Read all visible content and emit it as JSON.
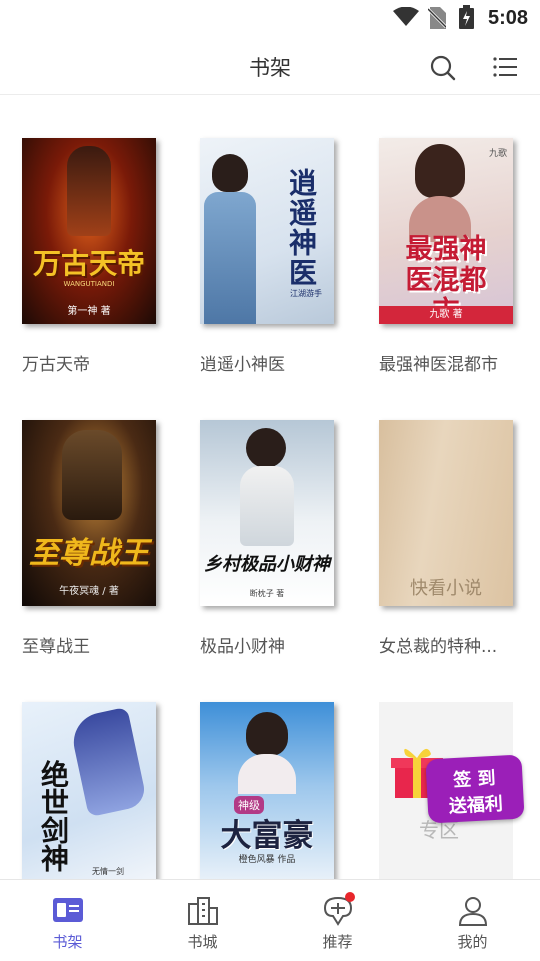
{
  "status_bar": {
    "time": "5:08"
  },
  "header": {
    "title": "书架"
  },
  "books": [
    {
      "title": "万古天帝",
      "cover_text": {
        "main": "万古天帝",
        "pinyin": "WANGUTIANDI",
        "author": "第一神 著"
      }
    },
    {
      "title": "逍遥小神医",
      "cover_text": {
        "main": "逍遥神医",
        "author": "江湖游手"
      }
    },
    {
      "title": "最强神医混都市",
      "cover_text": {
        "main": "最强神医混都市",
        "author": "九歌 著",
        "corner": "九歌"
      }
    },
    {
      "title": "至尊战王",
      "cover_text": {
        "main": "至尊战王",
        "author": "午夜冥魂 / 著"
      }
    },
    {
      "title": "极品小财神",
      "cover_text": {
        "main": "乡村极品小财神",
        "author": "断枕子 著"
      }
    },
    {
      "title": "女总裁的特种...",
      "cover_text": {
        "main": "快看小说"
      }
    },
    {
      "title": "",
      "cover_text": {
        "main": "绝世剑神",
        "author": "无情一剑"
      }
    },
    {
      "title": "",
      "cover_text": {
        "main": "大富豪",
        "tag": "神级",
        "author": "橙色风暴 作品"
      }
    },
    {
      "title": "",
      "cover_text": {
        "main": "专区",
        "promo_line1": "签 到",
        "promo_line2": "送福利"
      }
    }
  ],
  "bottom_nav": [
    {
      "label": "书架",
      "icon": "bookshelf-icon",
      "active": true
    },
    {
      "label": "书城",
      "icon": "city-icon",
      "active": false
    },
    {
      "label": "推荐",
      "icon": "recommend-icon",
      "active": false
    },
    {
      "label": "我的",
      "icon": "profile-icon",
      "active": false
    }
  ],
  "colors": {
    "accent": "#5b5bd6",
    "badge": "#e8262b",
    "promo": "#9b1fb8"
  }
}
